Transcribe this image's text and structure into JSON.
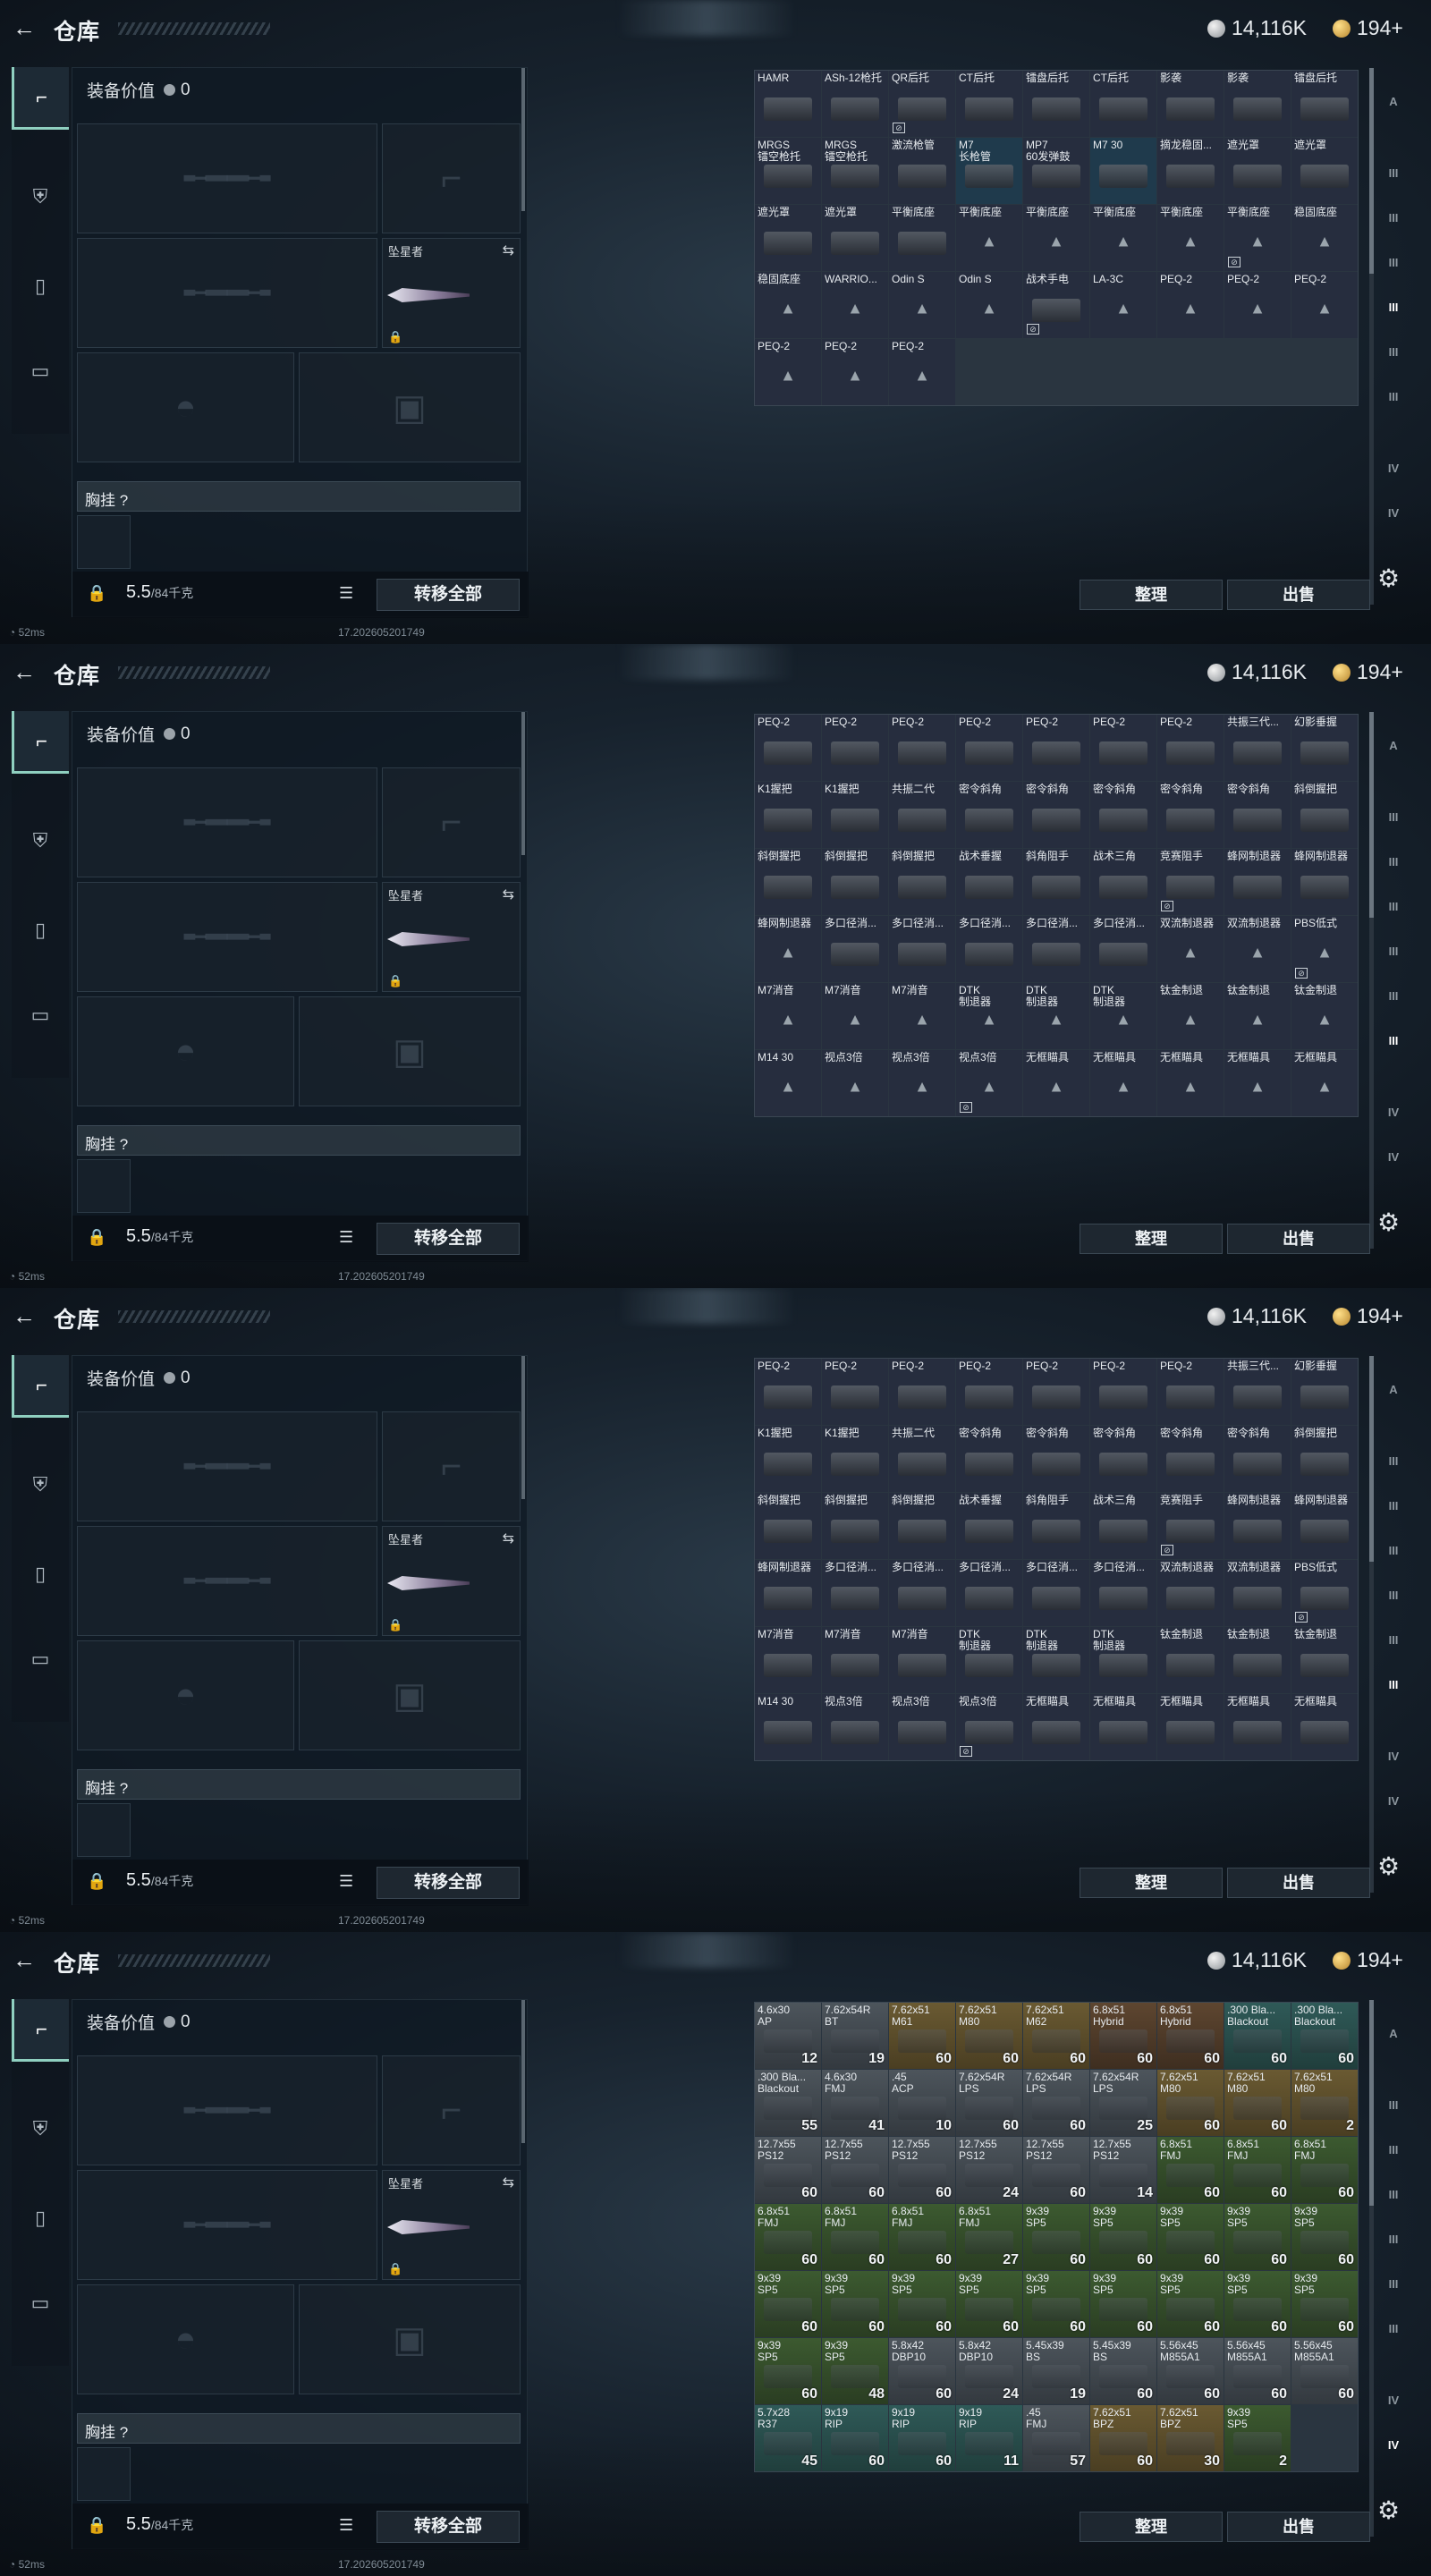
{
  "topbar": {
    "back_icon": "←",
    "title": "仓库",
    "silver": "14,116K",
    "gold": "194+"
  },
  "left_nav": [
    "pistol-icon",
    "armor-icon",
    "backpack-icon",
    "briefcase-icon"
  ],
  "equipment": {
    "value_label": "装备价值",
    "value": "0",
    "melee_label": "坠星者",
    "chest_label": "胸挂",
    "chest_help": "?",
    "weight": "5.5",
    "weight_max": "/84千克",
    "transfer_button": "转移全部"
  },
  "buttons": {
    "sort": "整理",
    "sell": "出售"
  },
  "status": {
    "ping": "52ms",
    "version": "17.202605201749"
  },
  "right_nav": [
    "A",
    "III",
    "III",
    "III",
    "III",
    "III",
    "III",
    "IV",
    "IV"
  ],
  "panels": [
    {
      "cells": [
        {
          "n": "HAMR",
          "img": 1
        },
        {
          "n": "ASh-12枪托",
          "img": 1
        },
        {
          "n": "QR后托",
          "img": 1,
          "b": 1
        },
        {
          "n": "CT后托",
          "img": 1
        },
        {
          "n": "镭盘后托",
          "img": 1
        },
        {
          "n": "CT后托",
          "img": 1
        },
        {
          "n": "影袭",
          "img": 1
        },
        {
          "n": "影袭",
          "img": 1
        },
        {
          "n": "镭盘后托",
          "img": 1
        },
        {
          "n": "MRGS\n镭空枪托",
          "img": 1
        },
        {
          "n": "MRGS\n镭空枪托",
          "img": 1
        },
        {
          "n": "激流枪管",
          "img": 1
        },
        {
          "n": "M7\n长枪管",
          "img": 1,
          "sel": 1
        },
        {
          "n": "MP7\n60发弹鼓",
          "img": 1
        },
        {
          "n": "M7 30",
          "img": 1,
          "sel": 1
        },
        {
          "n": "摘龙稳固...",
          "img": 1
        },
        {
          "n": "遮光罩",
          "img": 1
        },
        {
          "n": "遮光罩",
          "img": 1
        },
        {
          "n": "遮光罩",
          "img": 1
        },
        {
          "n": "遮光罩",
          "img": 1
        },
        {
          "n": "平衡底座",
          "img": 1
        },
        {
          "n": "平衡底座"
        },
        {
          "n": "平衡底座"
        },
        {
          "n": "平衡底座"
        },
        {
          "n": "平衡底座"
        },
        {
          "n": "平衡底座",
          "b": 1
        },
        {
          "n": "稳固底座"
        },
        {
          "n": "稳固底座"
        },
        {
          "n": "WARRIO..."
        },
        {
          "n": "Odin S"
        },
        {
          "n": "Odin S"
        },
        {
          "n": "战术手电",
          "img": 1,
          "b": 1
        },
        {
          "n": "LA-3C"
        },
        {
          "n": "PEQ-2"
        },
        {
          "n": "PEQ-2"
        },
        {
          "n": "PEQ-2"
        },
        {
          "n": "PEQ-2"
        },
        {
          "n": "PEQ-2"
        },
        {
          "n": "PEQ-2"
        }
      ]
    },
    {
      "cells": [
        {
          "n": "PEQ-2",
          "img": 1
        },
        {
          "n": "PEQ-2",
          "img": 1
        },
        {
          "n": "PEQ-2",
          "img": 1
        },
        {
          "n": "PEQ-2",
          "img": 1
        },
        {
          "n": "PEQ-2",
          "img": 1
        },
        {
          "n": "PEQ-2",
          "img": 1
        },
        {
          "n": "PEQ-2",
          "img": 1
        },
        {
          "n": "共振三代...",
          "img": 1
        },
        {
          "n": "幻影垂握",
          "img": 1
        },
        {
          "n": "K1握把",
          "img": 1
        },
        {
          "n": "K1握把",
          "img": 1
        },
        {
          "n": "共振二代",
          "img": 1
        },
        {
          "n": "密令斜角",
          "img": 1
        },
        {
          "n": "密令斜角",
          "img": 1
        },
        {
          "n": "密令斜角",
          "img": 1
        },
        {
          "n": "密令斜角",
          "img": 1
        },
        {
          "n": "密令斜角",
          "img": 1
        },
        {
          "n": "斜倒握把",
          "img": 1
        },
        {
          "n": "斜倒握把",
          "img": 1
        },
        {
          "n": "斜倒握把",
          "img": 1
        },
        {
          "n": "斜倒握把",
          "img": 1
        },
        {
          "n": "战术垂握",
          "img": 1
        },
        {
          "n": "斜角阻手",
          "img": 1
        },
        {
          "n": "战术三角",
          "img": 1
        },
        {
          "n": "竞赛阻手",
          "img": 1,
          "b": 1
        },
        {
          "n": "蜂网制退器",
          "img": 1
        },
        {
          "n": "蜂网制退器",
          "img": 1
        },
        {
          "n": "蜂网制退器"
        },
        {
          "n": "多口径消...",
          "img": 1
        },
        {
          "n": "多口径消...",
          "img": 1
        },
        {
          "n": "多口径消...",
          "img": 1
        },
        {
          "n": "多口径消...",
          "img": 1
        },
        {
          "n": "多口径消...",
          "img": 1
        },
        {
          "n": "双流制退器"
        },
        {
          "n": "双流制退器"
        },
        {
          "n": "PBS低式",
          "b": 1
        },
        {
          "n": "M7消音"
        },
        {
          "n": "M7消音"
        },
        {
          "n": "M7消音"
        },
        {
          "n": "DTK\n制退器"
        },
        {
          "n": "DTK\n制退器"
        },
        {
          "n": "DTK\n制退器"
        },
        {
          "n": "钛金制退"
        },
        {
          "n": "钛金制退"
        },
        {
          "n": "钛金制退"
        },
        {
          "n": "M14 30"
        },
        {
          "n": "视点3倍"
        },
        {
          "n": "视点3倍"
        },
        {
          "n": "视点3倍",
          "b": 1
        },
        {
          "n": "无框瞄具"
        },
        {
          "n": "无框瞄具"
        },
        {
          "n": "无框瞄具"
        },
        {
          "n": "无框瞄具"
        },
        {
          "n": "无框瞄具"
        }
      ]
    },
    {
      "cells": [
        {
          "n": "PEQ-2",
          "img": 1
        },
        {
          "n": "PEQ-2",
          "img": 1
        },
        {
          "n": "PEQ-2",
          "img": 1
        },
        {
          "n": "PEQ-2",
          "img": 1
        },
        {
          "n": "PEQ-2",
          "img": 1
        },
        {
          "n": "PEQ-2",
          "img": 1
        },
        {
          "n": "PEQ-2",
          "img": 1
        },
        {
          "n": "共振三代...",
          "img": 1
        },
        {
          "n": "幻影垂握",
          "img": 1
        },
        {
          "n": "K1握把",
          "img": 1
        },
        {
          "n": "K1握把",
          "img": 1
        },
        {
          "n": "共振二代",
          "img": 1
        },
        {
          "n": "密令斜角",
          "img": 1
        },
        {
          "n": "密令斜角",
          "img": 1
        },
        {
          "n": "密令斜角",
          "img": 1
        },
        {
          "n": "密令斜角",
          "img": 1
        },
        {
          "n": "密令斜角",
          "img": 1
        },
        {
          "n": "斜倒握把",
          "img": 1
        },
        {
          "n": "斜倒握把",
          "img": 1
        },
        {
          "n": "斜倒握把",
          "img": 1
        },
        {
          "n": "斜倒握把",
          "img": 1
        },
        {
          "n": "战术垂握",
          "img": 1
        },
        {
          "n": "斜角阻手",
          "img": 1
        },
        {
          "n": "战术三角",
          "img": 1
        },
        {
          "n": "竞赛阻手",
          "img": 1,
          "b": 1
        },
        {
          "n": "蜂网制退器",
          "img": 1
        },
        {
          "n": "蜂网制退器",
          "img": 1
        },
        {
          "n": "蜂网制退器",
          "img": 1
        },
        {
          "n": "多口径消...",
          "img": 1
        },
        {
          "n": "多口径消...",
          "img": 1
        },
        {
          "n": "多口径消...",
          "img": 1
        },
        {
          "n": "多口径消...",
          "img": 1
        },
        {
          "n": "多口径消...",
          "img": 1
        },
        {
          "n": "双流制退器",
          "img": 1
        },
        {
          "n": "双流制退器",
          "img": 1
        },
        {
          "n": "PBS低式",
          "img": 1,
          "b": 1
        },
        {
          "n": "M7消音",
          "img": 1
        },
        {
          "n": "M7消音",
          "img": 1
        },
        {
          "n": "M7消音",
          "img": 1
        },
        {
          "n": "DTK\n制退器",
          "img": 1
        },
        {
          "n": "DTK\n制退器",
          "img": 1
        },
        {
          "n": "DTK\n制退器",
          "img": 1
        },
        {
          "n": "钛金制退",
          "img": 1
        },
        {
          "n": "钛金制退",
          "img": 1
        },
        {
          "n": "钛金制退",
          "img": 1
        },
        {
          "n": "M14 30",
          "img": 1
        },
        {
          "n": "视点3倍",
          "img": 1
        },
        {
          "n": "视点3倍",
          "img": 1
        },
        {
          "n": "视点3倍",
          "img": 1,
          "b": 1
        },
        {
          "n": "无框瞄具",
          "img": 1
        },
        {
          "n": "无框瞄具",
          "img": 1
        },
        {
          "n": "无框瞄具",
          "img": 1
        },
        {
          "n": "无框瞄具",
          "img": 1
        },
        {
          "n": "无框瞄具",
          "img": 1
        }
      ]
    },
    {
      "cells": [
        {
          "n": "4.6x30\nAP",
          "c": "12",
          "t": "grey"
        },
        {
          "n": "7.62x54R\nBT",
          "c": "19",
          "t": "grey"
        },
        {
          "n": "7.62x51\nM61",
          "c": "60",
          "t": "gold"
        },
        {
          "n": "7.62x51\nM80",
          "c": "60",
          "t": "gold"
        },
        {
          "n": "7.62x51\nM62",
          "c": "60",
          "t": "gold"
        },
        {
          "n": "6.8x51\nHybrid",
          "c": "60",
          "t": "brown"
        },
        {
          "n": "6.8x51\nHybrid",
          "c": "60",
          "t": "brown"
        },
        {
          "n": ".300 Bla...\nBlackout",
          "c": "60",
          "t": "teal"
        },
        {
          "n": ".300 Bla...\nBlackout",
          "c": "60",
          "t": "teal"
        },
        {
          "n": ".300 Bla...\nBlackout",
          "c": "55",
          "t": "grey"
        },
        {
          "n": "4.6x30\nFMJ",
          "c": "41",
          "t": "grey"
        },
        {
          "n": ".45\nACP",
          "c": "10",
          "t": "grey"
        },
        {
          "n": "7.62x54R\nLPS",
          "c": "60",
          "t": "grey"
        },
        {
          "n": "7.62x54R\nLPS",
          "c": "60",
          "t": "grey"
        },
        {
          "n": "7.62x54R\nLPS",
          "c": "25",
          "t": "grey"
        },
        {
          "n": "7.62x51\nM80",
          "c": "60",
          "t": "gold"
        },
        {
          "n": "7.62x51\nM80",
          "c": "60",
          "t": "gold"
        },
        {
          "n": "7.62x51\nM80",
          "c": "2",
          "t": "gold"
        },
        {
          "n": "12.7x55\nPS12",
          "c": "60",
          "t": "grey"
        },
        {
          "n": "12.7x55\nPS12",
          "c": "60",
          "t": "grey"
        },
        {
          "n": "12.7x55\nPS12",
          "c": "60",
          "t": "grey"
        },
        {
          "n": "12.7x55\nPS12",
          "c": "24",
          "t": "grey"
        },
        {
          "n": "12.7x55\nPS12",
          "c": "60",
          "t": "grey"
        },
        {
          "n": "12.7x55\nPS12",
          "c": "14",
          "t": "grey"
        },
        {
          "n": "6.8x51\nFMJ",
          "c": "60",
          "t": "green"
        },
        {
          "n": "6.8x51\nFMJ",
          "c": "60",
          "t": "green"
        },
        {
          "n": "6.8x51\nFMJ",
          "c": "60",
          "t": "green"
        },
        {
          "n": "6.8x51\nFMJ",
          "c": "60",
          "t": "green"
        },
        {
          "n": "6.8x51\nFMJ",
          "c": "60",
          "t": "green"
        },
        {
          "n": "6.8x51\nFMJ",
          "c": "60",
          "t": "green"
        },
        {
          "n": "6.8x51\nFMJ",
          "c": "27",
          "t": "green"
        },
        {
          "n": "9x39\nSP5",
          "c": "60",
          "t": "green"
        },
        {
          "n": "9x39\nSP5",
          "c": "60",
          "t": "green"
        },
        {
          "n": "9x39\nSP5",
          "c": "60",
          "t": "green"
        },
        {
          "n": "9x39\nSP5",
          "c": "60",
          "t": "green"
        },
        {
          "n": "9x39\nSP5",
          "c": "60",
          "t": "green"
        },
        {
          "n": "9x39\nSP5",
          "c": "60",
          "t": "green"
        },
        {
          "n": "9x39\nSP5",
          "c": "60",
          "t": "green"
        },
        {
          "n": "9x39\nSP5",
          "c": "60",
          "t": "green"
        },
        {
          "n": "9x39\nSP5",
          "c": "60",
          "t": "green"
        },
        {
          "n": "9x39\nSP5",
          "c": "60",
          "t": "green"
        },
        {
          "n": "9x39\nSP5",
          "c": "60",
          "t": "green"
        },
        {
          "n": "9x39\nSP5",
          "c": "60",
          "t": "green"
        },
        {
          "n": "9x39\nSP5",
          "c": "60",
          "t": "green"
        },
        {
          "n": "9x39\nSP5",
          "c": "60",
          "t": "green"
        },
        {
          "n": "9x39\nSP5",
          "c": "60",
          "t": "green"
        },
        {
          "n": "9x39\nSP5",
          "c": "48",
          "t": "green"
        },
        {
          "n": "5.8x42\nDBP10",
          "c": "60",
          "t": "grey"
        },
        {
          "n": "5.8x42\nDBP10",
          "c": "24",
          "t": "grey"
        },
        {
          "n": "5.45x39\nBS",
          "c": "19",
          "t": "grey"
        },
        {
          "n": "5.45x39\nBS",
          "c": "60",
          "t": "grey"
        },
        {
          "n": "5.56x45\nM855A1",
          "c": "60",
          "t": "grey"
        },
        {
          "n": "5.56x45\nM855A1",
          "c": "60",
          "t": "grey"
        },
        {
          "n": "5.56x45\nM855A1",
          "c": "60",
          "t": "grey"
        },
        {
          "n": "5.7x28\nR37",
          "c": "45",
          "t": "teal"
        },
        {
          "n": "9x19\nRIP",
          "c": "60",
          "t": "teal"
        },
        {
          "n": "9x19\nRIP",
          "c": "60",
          "t": "teal"
        },
        {
          "n": "9x19\nRIP",
          "c": "11",
          "t": "teal"
        },
        {
          "n": ".45\nFMJ",
          "c": "57",
          "t": "grey"
        },
        {
          "n": "7.62x51\nBPZ",
          "c": "60",
          "t": "gold"
        },
        {
          "n": "7.62x51\nBPZ",
          "c": "30",
          "t": "gold"
        },
        {
          "n": "9x39\nSP5",
          "c": "2",
          "t": "green"
        }
      ]
    }
  ]
}
